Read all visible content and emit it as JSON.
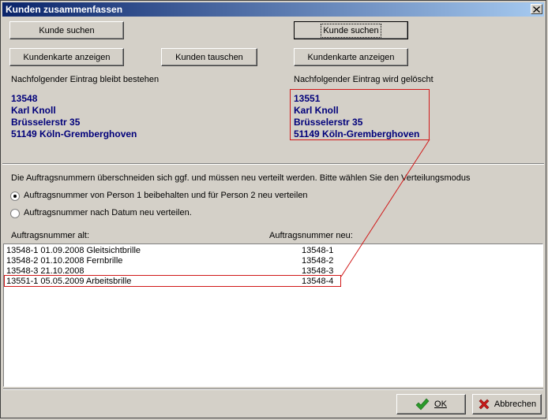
{
  "window": {
    "title": "Kunden zusammenfassen"
  },
  "left": {
    "search_label": "Kunde suchen",
    "card_label": "Kundenkarte anzeigen",
    "caption": "Nachfolgender Eintrag bleibt bestehen",
    "customer": {
      "number": "13548",
      "name": "Karl Knoll",
      "street": "Brüsselerstr 35",
      "city": "51149 Köln-Gremberghoven"
    }
  },
  "center": {
    "swap_label": "Kunden tauschen"
  },
  "right": {
    "search_label": "Kunde suchen",
    "card_label": "Kundenkarte anzeigen",
    "caption": "Nachfolgender Eintrag wird gelöscht",
    "customer": {
      "number": "13551",
      "name": "Karl Knoll",
      "street": "Brüsselerstr 35",
      "city": "51149 Köln-Gremberghoven"
    }
  },
  "info_text": "Die Auftragsnummern überschneiden sich ggf. und müssen neu verteilt werden. Bitte wählen Sie den Verteilungsmodus",
  "options": [
    {
      "label": "Auftragsnummer von Person 1 beibehalten und für Person 2 neu verteilen",
      "checked": true
    },
    {
      "label": "Auftragsnummer nach Datum neu verteilen.",
      "checked": false
    }
  ],
  "list": {
    "header_old": "Auftragsnummer alt:",
    "header_new": "Auftragsnummer neu:",
    "rows": [
      {
        "old": "13548-1  01.09.2008  Gleitsichtbrille",
        "new": "13548-1"
      },
      {
        "old": "13548-2  01.10.2008  Fernbrille",
        "new": "13548-2"
      },
      {
        "old": "13548-3  21.10.2008",
        "new": "13548-3"
      },
      {
        "old": "13551-1  05.05.2009  Arbeitsbrille",
        "new": "13548-4"
      }
    ]
  },
  "footer": {
    "ok_label": "OK",
    "cancel_label": "Abbrechen"
  },
  "colors": {
    "titlebar": "#0a246a",
    "address_text": "#00007a",
    "highlight": "#d01818",
    "ok_icon": "#2a9a2a",
    "cancel_icon": "#c81818"
  },
  "icons": {
    "close": "close-icon",
    "ok": "checkmark-icon",
    "cancel": "x-icon"
  }
}
